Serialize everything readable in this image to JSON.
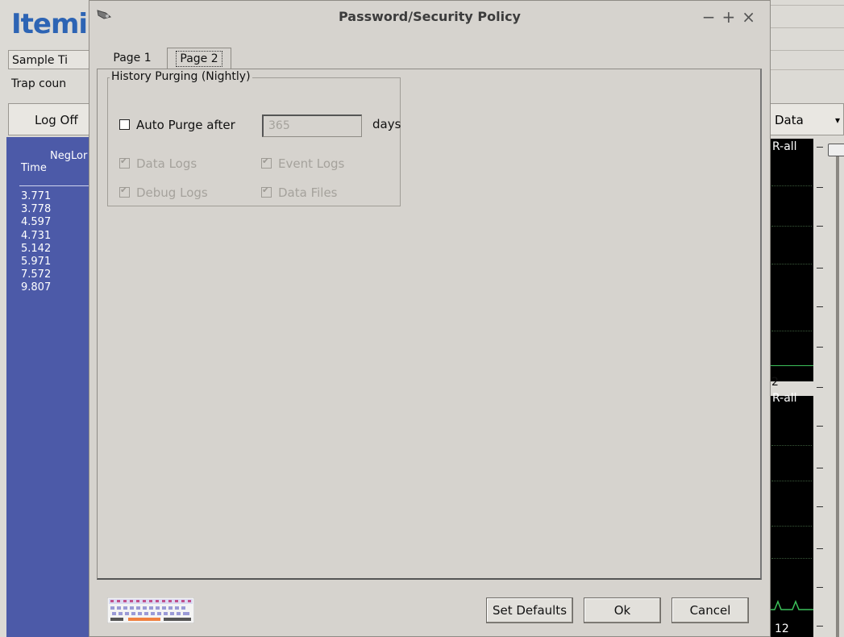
{
  "background_app": {
    "logo": "Itemi",
    "sample_time": "Sample Ti",
    "trap_count": "Trap coun",
    "log_off": "Log Off",
    "data_menu": "Data",
    "panel_header_1": "NegLor",
    "panel_header_2": "Time",
    "times": [
      "3.771",
      "3.778",
      "4.597",
      "4.731",
      "5.142",
      "5.971",
      "7.572",
      "9.807"
    ],
    "plot_label_1": "R-all",
    "plot_label_2": "R-all",
    "plot_value_mid": "2",
    "plot_value_bottom": "12"
  },
  "dialog": {
    "title": "Password/Security Policy",
    "controls": [
      "−",
      "+",
      "×"
    ],
    "tabs": [
      {
        "label": "Page 1",
        "selected": false
      },
      {
        "label": "Page 2",
        "selected": true
      }
    ],
    "history_group": {
      "title": "History Purging (Nightly)",
      "auto_purge": {
        "label": "Auto Purge after",
        "checked": false
      },
      "days_value": "365",
      "days_label": "days",
      "options": [
        {
          "label": "Data Logs",
          "checked": true,
          "enabled": false
        },
        {
          "label": "Event Logs",
          "checked": true,
          "enabled": false
        },
        {
          "label": "Debug Logs",
          "checked": true,
          "enabled": false
        },
        {
          "label": "Data Files",
          "checked": true,
          "enabled": false
        }
      ]
    },
    "buttons": {
      "set_defaults": "Set Defaults",
      "ok": "Ok",
      "cancel": "Cancel"
    },
    "icons": {
      "title_icon": "app-icon",
      "keyboard": "virtual-keyboard-icon"
    }
  }
}
